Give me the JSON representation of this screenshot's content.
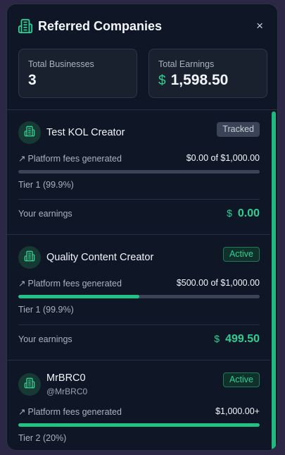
{
  "header": {
    "title": "Referred Companies",
    "close": "×"
  },
  "stats": {
    "total_businesses_label": "Total Businesses",
    "total_businesses_value": "3",
    "total_earnings_label": "Total Earnings",
    "currency": "$",
    "total_earnings_value": "1,598.50"
  },
  "companies": [
    {
      "name": "Test KOL Creator",
      "status": "Tracked",
      "fees_label": "Platform fees generated",
      "fees_value": "$0.00 of $1,000.00",
      "progress": 0.0,
      "tier": "Tier 1 (99.9%)",
      "earnings_label": "Your earnings",
      "earnings_currency": "$",
      "earnings_value": "0.00"
    },
    {
      "name": "Quality Content Creator",
      "status": "Active",
      "fees_label": "Platform fees generated",
      "fees_value": "$500.00 of $1,000.00",
      "progress": 0.5,
      "tier": "Tier 1 (99.9%)",
      "earnings_label": "Your earnings",
      "earnings_currency": "$",
      "earnings_value": "499.50"
    },
    {
      "name": "MrBRC0",
      "handle": "@MrBRC0",
      "status": "Active",
      "fees_label": "Platform fees generated",
      "fees_value": "$1,000.00+",
      "progress": 1.0,
      "tier": "Tier 2 (20%)"
    }
  ],
  "colors": {
    "accent": "#2fcf92",
    "panel": "#0f1726",
    "background": "#2b2744"
  },
  "icons": {
    "header": "building-icon",
    "avatar": "building-icon",
    "trend": "trending-up-icon"
  }
}
